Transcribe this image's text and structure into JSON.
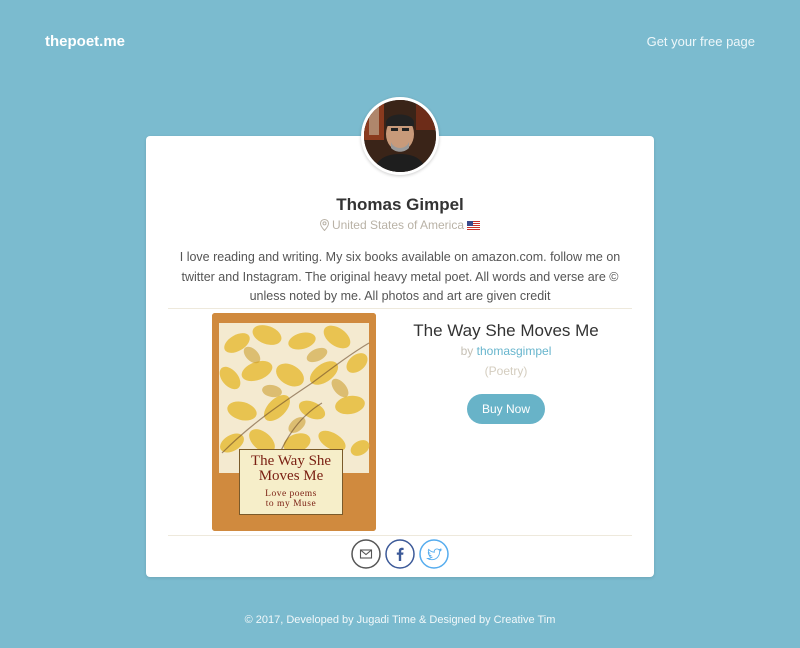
{
  "nav": {
    "brand": "thepoet.me",
    "cta": "Get your free page"
  },
  "profile": {
    "avatar_icon": "user-photo",
    "name": "Thomas Gimpel",
    "location": "United States of America",
    "location_icon": "map-pin-icon",
    "flag_icon": "us-flag-icon",
    "bio": "I love reading and writing. My six books available on amazon.com. follow me on twitter and Instagram. The original heavy metal poet. All words and verse are © unless noted by me. All photos and art are given credit"
  },
  "book": {
    "title": "The Way She Moves Me",
    "by_prefix": "by",
    "author_link": "thomasgimpel",
    "genre": "(Poetry)",
    "buy_label": "Buy Now",
    "cover_title_line1": "The Way She",
    "cover_title_line2": "Moves Me",
    "cover_subtitle_line1": "Love poems",
    "cover_subtitle_line2": "to my Muse"
  },
  "socials": [
    {
      "name": "email",
      "icon": "envelope-icon",
      "color": "#555555"
    },
    {
      "name": "facebook",
      "icon": "facebook-icon",
      "color": "#3b5998"
    },
    {
      "name": "twitter",
      "icon": "twitter-icon",
      "color": "#55acee"
    }
  ],
  "footer": {
    "text": "© 2017, Developed by Jugadi Time & Designed by Creative Tim"
  },
  "colors": {
    "background": "#7bbbcf",
    "accent": "#68b3c8",
    "card": "#ffffff"
  }
}
